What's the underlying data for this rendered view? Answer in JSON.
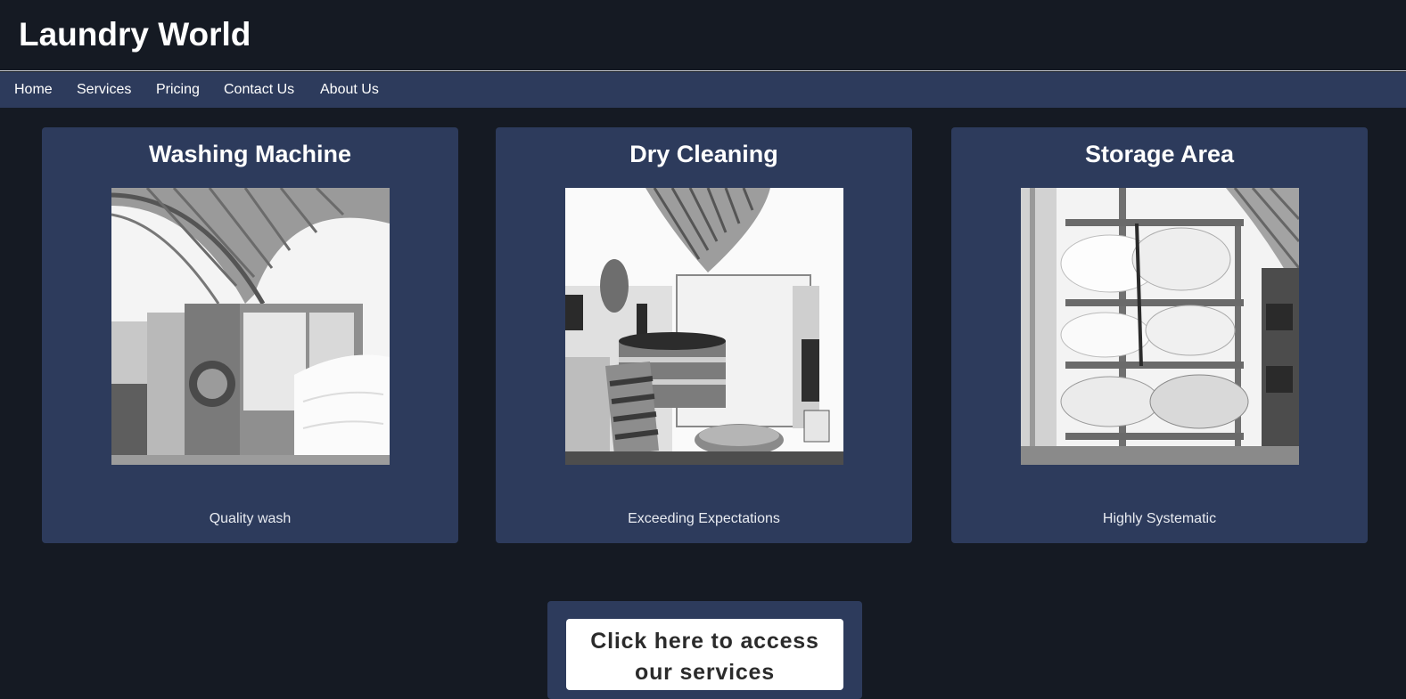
{
  "header": {
    "title": "Laundry World"
  },
  "nav": {
    "items": [
      {
        "label": "Home"
      },
      {
        "label": "Services"
      },
      {
        "label": "Pricing"
      },
      {
        "label": "Contact Us"
      },
      {
        "label": "About Us"
      }
    ]
  },
  "cards": [
    {
      "title": "Washing Machine",
      "caption": "Quality wash",
      "image": "washing-machine-photo"
    },
    {
      "title": "Dry Cleaning",
      "caption": "Exceeding Expectations",
      "image": "dry-cleaning-photo"
    },
    {
      "title": "Storage Area",
      "caption": "Highly Systematic",
      "image": "storage-area-photo"
    }
  ],
  "cta": {
    "label": "Click here to access our services"
  },
  "colors": {
    "background": "#151a23",
    "navbar": "#2d3b5c",
    "card": "#2d3b5c",
    "text": "#ffffff",
    "button": "#ffffff",
    "button_text": "#2b2b2b"
  }
}
